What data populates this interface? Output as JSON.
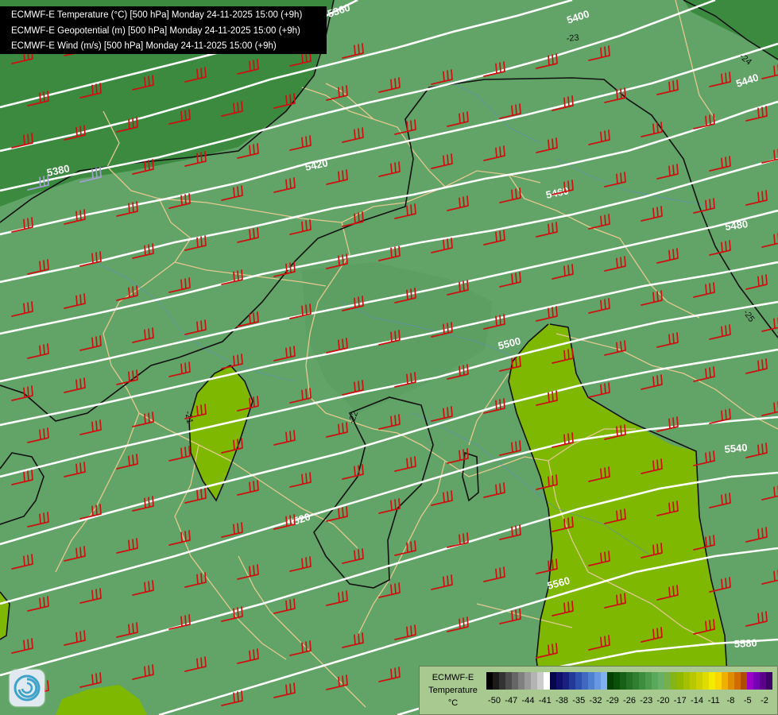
{
  "header": {
    "line1": "ECMWF-E Temperature (°C) [500 hPa] Monday 24-11-2025 15:00 (+9h)",
    "line2": "ECMWF-E Geopotential (m) [500 hPa] Monday 24-11-2025 15:00 (+9h)",
    "line3": "ECMWF-E Wind (m/s) [500 hPa] Monday 24-11-2025 15:00 (+9h)"
  },
  "map": {
    "background_color": "#62a467",
    "cold_zone_color": "#3c8a40",
    "warm_zone_color": "#7eb800",
    "geopotential_line_color": "#ffffff",
    "temperature_line_color": "#111111",
    "border_color": "#e3c98f",
    "wind_barb_color": "#cc1111",
    "geopotential_labels": [
      "5360",
      "5380",
      "5400",
      "5420",
      "5440",
      "5460",
      "5480",
      "5500",
      "5520",
      "5540",
      "5560",
      "5580"
    ],
    "temperature_labels": [
      "-21",
      "-22",
      "-23",
      "-24",
      "-25"
    ]
  },
  "legend": {
    "title_line1": "ECMWF-E",
    "title_line2": "Temperature",
    "unit": "°C",
    "ticks": [
      "-50",
      "-47",
      "-44",
      "-41",
      "-38",
      "-35",
      "-32",
      "-29",
      "-26",
      "-23",
      "-20",
      "-17",
      "-14",
      "-11",
      "-8",
      "-5",
      "-2"
    ],
    "colors": [
      "#000000",
      "#1a1a1a",
      "#333333",
      "#4d4d4d",
      "#666666",
      "#808080",
      "#9a9a9a",
      "#b3b3b3",
      "#cccccc",
      "#ffffff",
      "#06064a",
      "#10106a",
      "#1a2080",
      "#243898",
      "#3050b0",
      "#4068c0",
      "#5080d0",
      "#6898e0",
      "#80b0f0",
      "#044004",
      "#0a500a",
      "#186018",
      "#247024",
      "#307e30",
      "#3e8c3e",
      "#4c9a4c",
      "#5aa85a",
      "#68b068",
      "#76b04a",
      "#84b418",
      "#90b800",
      "#a4c000",
      "#b8c800",
      "#ccd000",
      "#e0dc00",
      "#f4ec00",
      "#f8d800",
      "#f0b000",
      "#e08c00",
      "#d06c00",
      "#b04c00",
      "#9c00c8",
      "#7800b4",
      "#5c008c",
      "#3c0068"
    ]
  }
}
